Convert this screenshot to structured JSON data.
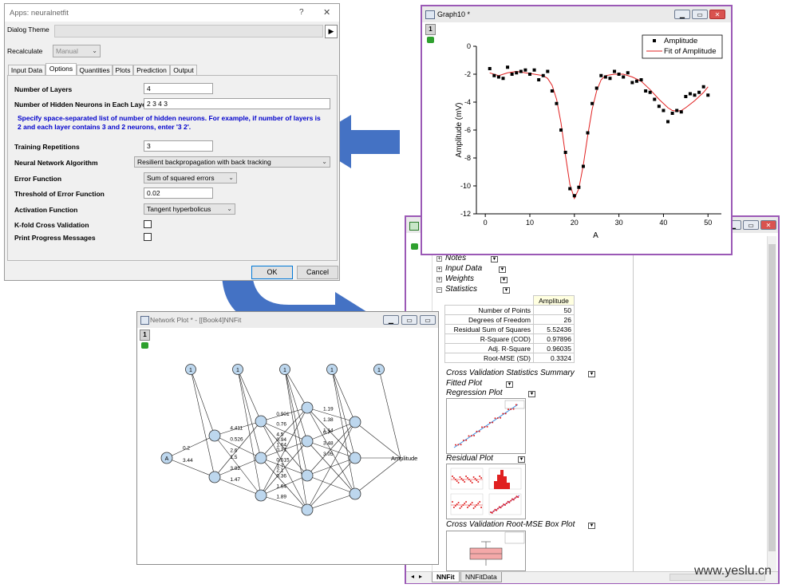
{
  "dialog": {
    "title": "Apps: neuralnetfit",
    "help_glyph": "?",
    "close_glyph": "✕",
    "theme_label": "Dialog Theme",
    "theme_arrow": "▶",
    "recalc_label": "Recalculate",
    "recalc_value": "Manual",
    "tabs": [
      "Input Data",
      "Options",
      "Quantities",
      "Plots",
      "Prediction",
      "Output"
    ],
    "fields": {
      "layers_label": "Number of Layers",
      "layers_value": "4",
      "neurons_label": "Number of Hidden Neurons in Each Layer",
      "neurons_value": "2 3 4 3",
      "hint": "Specify space-separated list of number of hidden neurons. For example, if number of layers is 2 and each layer contains 3 and 2 neurons, enter '3 2'.",
      "reps_label": "Training Repetitions",
      "reps_value": "3",
      "algo_label": "Neural Network Algorithm",
      "algo_value": "Resilient backpropagation with back tracking",
      "error_label": "Error Function",
      "error_value": "Sum of squared errors",
      "threshold_label": "Threshold of Error Function",
      "threshold_value": "0.02",
      "activation_label": "Activation Function",
      "activation_value": "Tangent hyperbolicus",
      "kfold_label": "K-fold Cross Validation",
      "progress_label": "Print Progress Messages"
    },
    "ok": "OK",
    "cancel": "Cancel"
  },
  "graph": {
    "title": "Graph10 *",
    "layer_num": "1",
    "min": "▁",
    "max": "▭",
    "close": "✕"
  },
  "network": {
    "title": "Network Plot * - [[Book4]NNFit",
    "layer_num": "1",
    "input_node": "A",
    "bias_label": "1",
    "output_label": "Amplitude",
    "weights": [
      "0.2",
      "3.44",
      "4.411",
      "0.526",
      "2.6",
      "1.5",
      "3.82",
      "1.47",
      "0.901",
      "0.76",
      "4.5",
      "1.64",
      "0.94",
      "0.71",
      "0.515",
      "2.1",
      "1.7",
      "0.36",
      "1.64",
      "1.89",
      "1.19",
      "1.38",
      "1.14",
      "0.7",
      "3.48",
      "3.05"
    ]
  },
  "report": {
    "tree": [
      "Notes",
      "Input Data",
      "Weights",
      "Statistics"
    ],
    "stats_header": "Amplitude",
    "stats": [
      {
        "label": "Number of Points",
        "value": "50"
      },
      {
        "label": "Degrees of Freedom",
        "value": "26"
      },
      {
        "label": "Residual Sum of Squares",
        "value": "5.52436"
      },
      {
        "label": "R-Square (COD)",
        "value": "0.97896"
      },
      {
        "label": "Adj. R-Square",
        "value": "0.96035"
      },
      {
        "label": "Root-MSE (SD)",
        "value": "0.3324"
      }
    ],
    "cv_summary": "Cross Validation Statistics Summary",
    "fitted_plot": "Fitted Plot",
    "regression_plot": "Regression Plot",
    "residual_plot": "Residual Plot",
    "cv_box": "Cross Validation Root-MSE Box Plot",
    "sheet_tabs": [
      "NNFit",
      "NNFitData"
    ]
  },
  "watermark": "www.yeslu.cn",
  "colors": {
    "arrow_blue": "#4472c4",
    "graph_frame": "#9b59b6",
    "fit_red": "#e02020",
    "hint_blue": "#0000cc",
    "node_fill": "#bdd7ee"
  },
  "chart_data": {
    "type": "scatter",
    "xlabel": "A",
    "ylabel": "Amplitude (mV)",
    "xlim": [
      -2,
      53
    ],
    "ylim": [
      -12,
      0
    ],
    "xticks": [
      0,
      10,
      20,
      30,
      40,
      50
    ],
    "yticks": [
      0,
      -2,
      -4,
      -6,
      -8,
      -10,
      -12
    ],
    "legend_position": "top-right",
    "series": [
      {
        "name": "Amplitude",
        "style": "marker",
        "x": [
          1,
          2,
          3,
          4,
          5,
          6,
          7,
          8,
          9,
          10,
          11,
          12,
          13,
          14,
          15,
          16,
          17,
          18,
          19,
          20,
          21,
          22,
          23,
          24,
          25,
          26,
          27,
          28,
          29,
          30,
          31,
          32,
          33,
          34,
          35,
          36,
          37,
          38,
          39,
          40,
          41,
          42,
          43,
          44,
          45,
          46,
          47,
          48,
          49,
          50
        ],
        "y": [
          -1.6,
          -2.1,
          -2.2,
          -2.3,
          -1.5,
          -2.0,
          -1.9,
          -1.8,
          -1.7,
          -2.0,
          -1.7,
          -2.4,
          -2.1,
          -1.8,
          -3.2,
          -4.1,
          -6.0,
          -7.6,
          -10.2,
          -10.7,
          -10.1,
          -8.6,
          -6.2,
          -4.1,
          -3.0,
          -2.1,
          -2.2,
          -2.3,
          -1.8,
          -2.0,
          -2.2,
          -1.9,
          -2.6,
          -2.5,
          -2.4,
          -3.2,
          -3.3,
          -3.8,
          -4.3,
          -4.6,
          -5.4,
          -4.8,
          -4.6,
          -4.7,
          -3.6,
          -3.4,
          -3.5,
          -3.3,
          -2.9,
          -3.5
        ]
      },
      {
        "name": "Fit of Amplitude",
        "style": "line",
        "x": [
          1,
          3,
          5,
          7,
          9,
          11,
          13,
          14,
          15,
          16,
          17,
          18,
          19,
          20,
          21,
          22,
          23,
          24,
          25,
          26,
          27,
          29,
          31,
          33,
          35,
          37,
          39,
          41,
          42,
          43,
          44,
          45,
          47,
          49,
          50
        ],
        "y": [
          -1.9,
          -2.1,
          -1.9,
          -1.8,
          -1.9,
          -2.0,
          -2.1,
          -2.3,
          -2.8,
          -3.8,
          -5.5,
          -7.8,
          -9.9,
          -10.9,
          -10.2,
          -8.5,
          -6.4,
          -4.5,
          -3.2,
          -2.4,
          -2.1,
          -2.0,
          -2.0,
          -2.2,
          -2.5,
          -3.1,
          -3.8,
          -4.4,
          -4.6,
          -4.65,
          -4.6,
          -4.4,
          -3.9,
          -3.3,
          -2.9
        ]
      }
    ]
  }
}
